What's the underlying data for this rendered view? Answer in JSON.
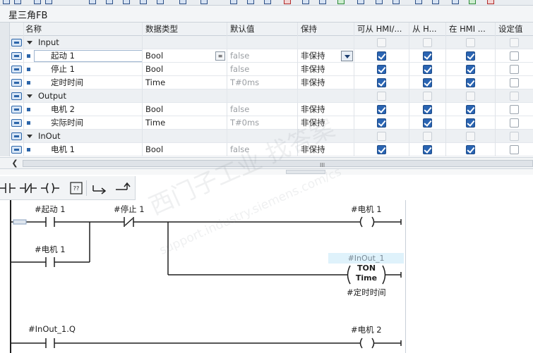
{
  "block_title": "星三角FB",
  "columns": {
    "name": "名称",
    "data_type": "数据类型",
    "default_value": "默认值",
    "retain": "保持",
    "accessible_hmi": "可从 HMI/...",
    "writable_hmi": "从 H...",
    "visible_hmi": "在 HMI ...",
    "setpoint": "设定值"
  },
  "sections": [
    {
      "name": "Input",
      "vars": [
        {
          "name": "起动 1",
          "type": "Bool",
          "default": "false",
          "retain": "非保持",
          "hmi": true,
          "hmi_w": true,
          "hmi_v": true
        },
        {
          "name": "停止 1",
          "type": "Bool",
          "default": "false",
          "retain": "非保持",
          "hmi": true,
          "hmi_w": true,
          "hmi_v": true
        },
        {
          "name": "定时时间",
          "type": "Time",
          "default": "T#0ms",
          "retain": "非保持",
          "hmi": true,
          "hmi_w": true,
          "hmi_v": true
        }
      ]
    },
    {
      "name": "Output",
      "vars": [
        {
          "name": "电机 2",
          "type": "Bool",
          "default": "false",
          "retain": "非保持",
          "hmi": true,
          "hmi_w": true,
          "hmi_v": true
        },
        {
          "name": "实际时间",
          "type": "Time",
          "default": "T#0ms",
          "retain": "非保持",
          "hmi": true,
          "hmi_w": true,
          "hmi_v": true
        }
      ]
    },
    {
      "name": "InOut",
      "vars": [
        {
          "name": "电机 1",
          "type": "Bool",
          "default": "false",
          "retain": "非保持",
          "hmi": true,
          "hmi_w": true,
          "hmi_v": true
        }
      ]
    }
  ],
  "scroll_grip": "III",
  "network": {
    "contact_start": "#起动 1",
    "contact_stop": "#停止 1",
    "contact_motor1": "#电机 1",
    "coil_motor1": "#电机 1",
    "ton_instance": "#InOut_1",
    "ton_name": "TON",
    "ton_type": "Time",
    "ton_pt": "#定时时间",
    "contact_inout_q": "#InOut_1.Q",
    "coil_motor2": "#电机 2"
  },
  "watermark": {
    "line1": "西门子工业  找答案",
    "line2": "support.industry.siemens.com/cs"
  },
  "colors": {
    "accent": "#2a64b2",
    "header_bg": "#eef1f4",
    "instance_bg": "#dff2fb"
  }
}
